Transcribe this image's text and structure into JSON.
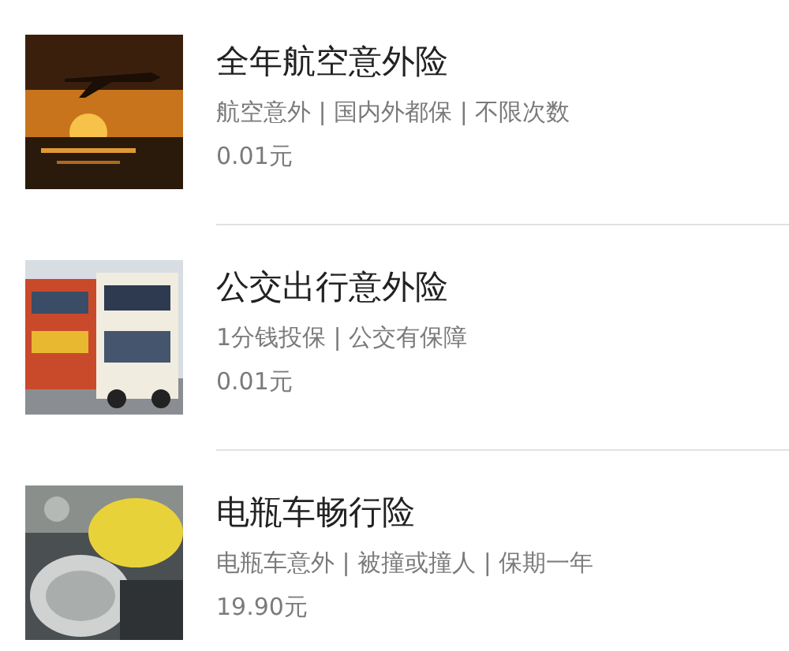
{
  "products": [
    {
      "title": "全年航空意外险",
      "subtitle": "航空意外 | 国内外都保 | 不限次数",
      "price": "0.01元"
    },
    {
      "title": "公交出行意外险",
      "subtitle": "1分钱投保 | 公交有保障",
      "price": "0.01元"
    },
    {
      "title": "电瓶车畅行险",
      "subtitle": "电瓶车意外 | 被撞或撞人 | 保期一年",
      "price": "19.90元"
    }
  ]
}
